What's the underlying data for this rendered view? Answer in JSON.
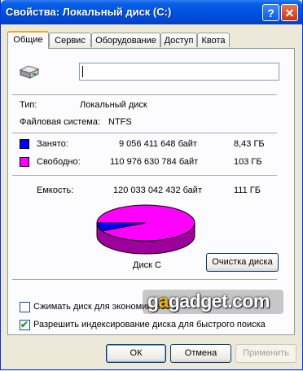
{
  "window": {
    "title": "Свойства: Локальный диск (C:)",
    "help_glyph": "?",
    "close_glyph": "✕"
  },
  "tabs": [
    {
      "label": "Общие",
      "active": true
    },
    {
      "label": "Сервис",
      "active": false
    },
    {
      "label": "Оборудование",
      "active": false
    },
    {
      "label": "Доступ",
      "active": false
    },
    {
      "label": "Квота",
      "active": false
    }
  ],
  "general": {
    "drive_name_value": "",
    "type_label": "Тип:",
    "type_value": "Локальный диск",
    "fs_label": "Файловая система:",
    "fs_value": "NTFS",
    "used": {
      "label": "Занято:",
      "bytes": "9 056 411 648 байт",
      "size": "8,43 ГБ",
      "color": "#0000ff"
    },
    "free": {
      "label": "Свободно:",
      "bytes": "110 976 630 784 байт",
      "size": "103 ГБ",
      "color": "#ff00ff"
    },
    "capacity": {
      "label": "Емкость:",
      "bytes": "120 033 042 432 байт",
      "size": "111 ГБ"
    },
    "disk_label": "Диск C",
    "cleanup_button": "Очистка диска",
    "compress_label": "Сжимать диск для экономии места",
    "compress_checked": false,
    "index_label": "Разрешить индексирование диска для быстрого поиска",
    "index_checked": true
  },
  "chart_data": {
    "type": "pie",
    "values": [
      9056411648,
      110976630784
    ],
    "labels": [
      "Занято",
      "Свободно"
    ],
    "colors": [
      "#0000ff",
      "#ff00ff"
    ],
    "title": "Диск C"
  },
  "footer": {
    "ok": "ОК",
    "cancel": "Отмена",
    "apply": "Применить"
  },
  "watermark": {
    "prefix": "g",
    "accent": "a",
    "rest": "gadget.com"
  }
}
